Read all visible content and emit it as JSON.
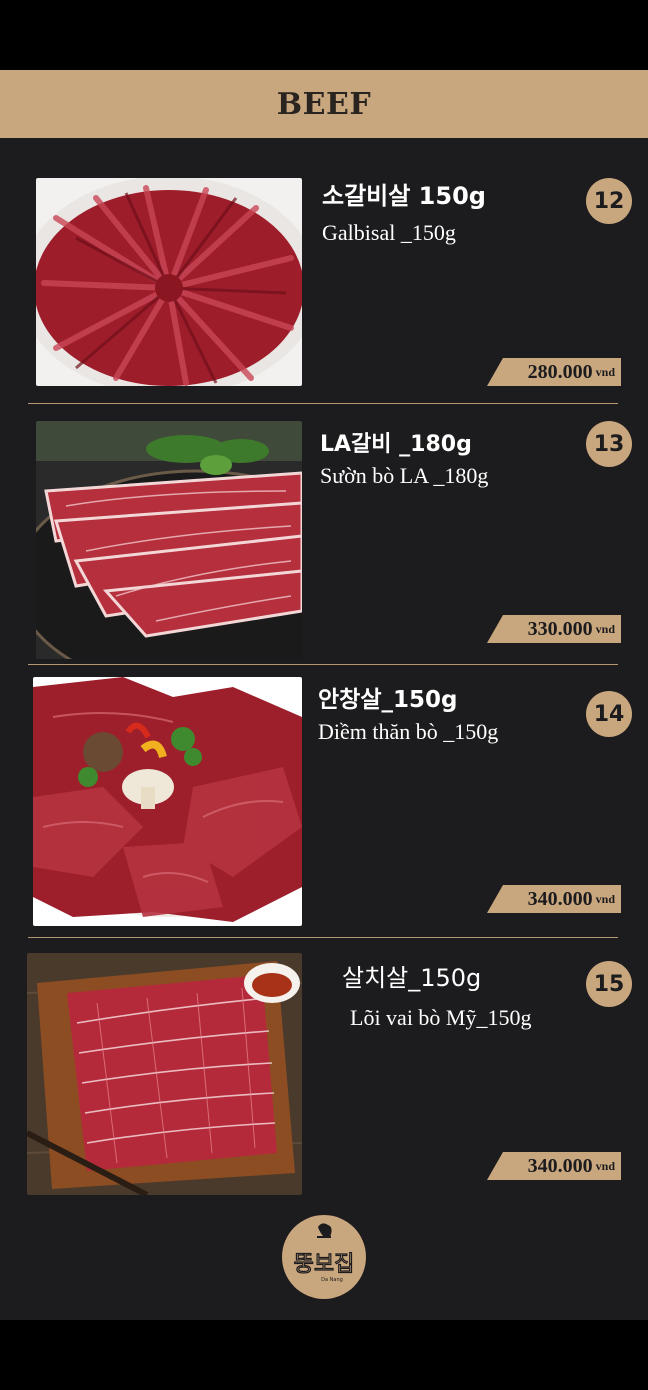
{
  "header": {
    "title": "BEEF"
  },
  "items": [
    {
      "number": "12",
      "name_ko": "소갈비살 150g",
      "name_vi": "Galbisal _150g",
      "price": "280.000",
      "currency": "vnd",
      "image": "beef-strips-platter"
    },
    {
      "number": "13",
      "name_ko": "LA갈비 _180g",
      "name_vi": "Sườn bò LA _180g",
      "price": "330.000",
      "currency": "vnd",
      "image": "la-short-ribs"
    },
    {
      "number": "14",
      "name_ko": "안창살_150g",
      "name_vi": "Diềm thăn bò  _150g",
      "price": "340.000",
      "currency": "vnd",
      "image": "skirt-steak-with-mushrooms"
    },
    {
      "number": "15",
      "name_ko": "살치살_150g",
      "name_vi": "Lõi vai bò Mỹ_150g",
      "price": "340.000",
      "currency": "vnd",
      "image": "sliced-chuck-on-board"
    }
  ],
  "logo": {
    "text": "뚱보집",
    "sub": "Da Nang"
  },
  "colors": {
    "accent": "#c9a77e",
    "background": "#1c1b1d",
    "page": "#000000"
  }
}
